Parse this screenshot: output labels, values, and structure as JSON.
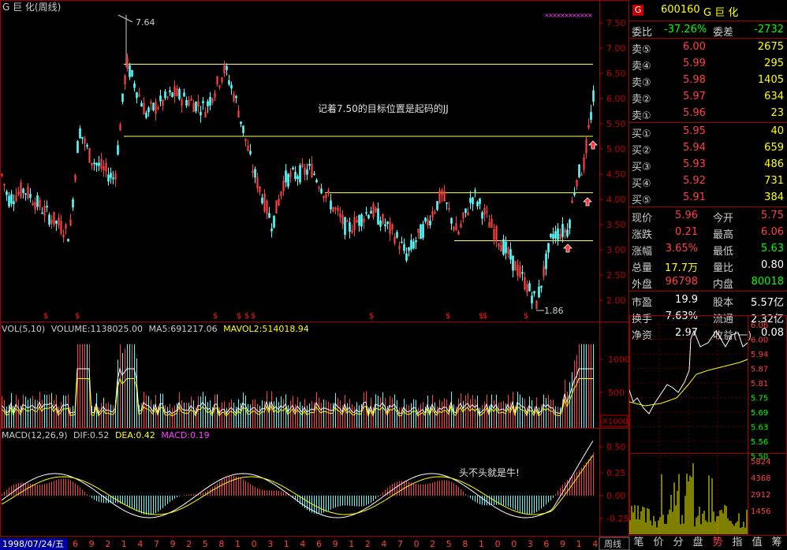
{
  "title": "G 巨  化(周线)",
  "annotation": "记着7.50的目标位置是起码的JJ",
  "annotation2": "头不头就是牛!",
  "price_high_label": "7.64",
  "price_low_label": "1.86",
  "main_axis_ticks": [
    "7.50",
    "7.00",
    "6.50",
    "6.00",
    "5.50",
    "5.00",
    "4.50",
    "4.00",
    "3.50",
    "3.00",
    "2.50",
    "2.00"
  ],
  "vol_header": {
    "name": "VOL(5,10)",
    "volume": "VOLUME:1138025.00",
    "ma5": "MA5:691217.06",
    "mavol2": "MAVOL2:514018.94"
  },
  "vol_axis_ticks": [
    "1000",
    "500"
  ],
  "vol_unit": "X1000",
  "macd_header": {
    "name": "MACD(12,26,9)",
    "dif": "DIF:0.52",
    "dea": "DEA:0.42",
    "macd": "MACD:0.19"
  },
  "macd_axis_ticks": [
    "0.50",
    "0.25",
    "0.00",
    "-0.25"
  ],
  "date_label": "1998/07/24/五",
  "date_ticks": [
    "6",
    "9",
    "2",
    "1",
    "4",
    "7",
    "9",
    "2",
    "5",
    "8",
    "1",
    "0",
    "3",
    "1",
    "4",
    "6",
    "9",
    "1",
    "2",
    "4",
    "7",
    "0",
    "2",
    "5",
    "8",
    "1",
    "0",
    "0",
    "3",
    "6",
    "9",
    "1",
    "4"
  ],
  "period_label": "周线",
  "stock": {
    "code": "600160",
    "name": "G 巨  化",
    "badge": "G"
  },
  "ratio": {
    "label": "委比",
    "value": "-37.26%",
    "diff_label": "委差",
    "diff_value": "-2732"
  },
  "sell": [
    {
      "label": "卖⑤",
      "price": "6.00",
      "vol": "2675"
    },
    {
      "label": "卖④",
      "price": "5.99",
      "vol": "295"
    },
    {
      "label": "卖③",
      "price": "5.98",
      "vol": "1405"
    },
    {
      "label": "卖②",
      "price": "5.97",
      "vol": "634"
    },
    {
      "label": "卖①",
      "price": "5.96",
      "vol": "23"
    }
  ],
  "buy": [
    {
      "label": "买①",
      "price": "5.95",
      "vol": "40"
    },
    {
      "label": "买②",
      "price": "5.94",
      "vol": "659"
    },
    {
      "label": "买③",
      "price": "5.93",
      "vol": "486"
    },
    {
      "label": "买④",
      "price": "5.92",
      "vol": "731"
    },
    {
      "label": "买⑤",
      "price": "5.91",
      "vol": "384"
    }
  ],
  "quote": [
    {
      "l1": "现价",
      "v1": "5.96",
      "l2": "今开",
      "v2": "5.75",
      "c1": "#ff4040",
      "c2": "#ff4040"
    },
    {
      "l1": "涨跌",
      "v1": "0.21",
      "l2": "最高",
      "v2": "6.06",
      "c1": "#ff4040",
      "c2": "#ff4040"
    },
    {
      "l1": "涨幅",
      "v1": "3.65%",
      "l2": "最低",
      "v2": "5.63",
      "c1": "#ff4040",
      "c2": "#00ff00"
    },
    {
      "l1": "总量",
      "v1": "17.7万",
      "l2": "量比",
      "v2": "0.80",
      "c1": "#ffff00",
      "c2": "#ffffff"
    },
    {
      "l1": "外盘",
      "v1": "96798",
      "l2": "内盘",
      "v2": "80018",
      "c1": "#ff4040",
      "c2": "#00ff00"
    }
  ],
  "fund": [
    {
      "l1": "市盈",
      "v1": "19.9",
      "l2": "股本",
      "v2": "5.57亿"
    },
    {
      "l1": "换手",
      "v1": "7.63%",
      "l2": "流通",
      "v2": "2.32亿"
    },
    {
      "l1": "净资",
      "v1": "2.97",
      "l2": "收益(一)",
      "v2": "0.08"
    }
  ],
  "mini_price_ticks": [
    "6.06",
    "6.00",
    "5.94",
    "5.87",
    "5.81",
    "5.75",
    "5.69",
    "5.63",
    "5.56",
    "5.50"
  ],
  "mini_vol_ticks": [
    "5824",
    "4368",
    "2912",
    "1456"
  ],
  "tabs": [
    "笔",
    "价",
    "分",
    "盘",
    "势",
    "指",
    "值",
    "筹"
  ],
  "active_tab": "势",
  "colors": {
    "up": "#ff4040",
    "down": "#54ffff",
    "ma": "#ffff00",
    "axis": "#c00000",
    "text": "#c0c0c0"
  }
}
